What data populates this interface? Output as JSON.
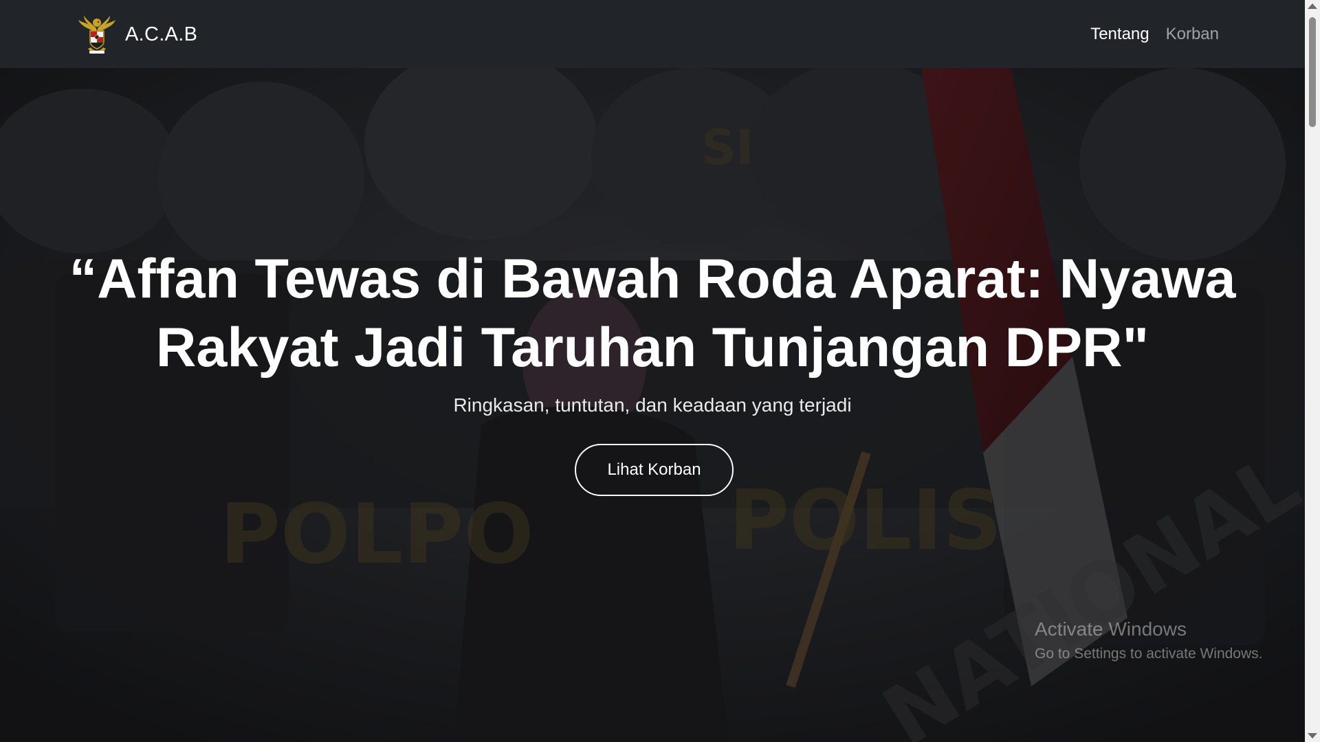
{
  "navbar": {
    "brand": "A.C.A.B",
    "links": [
      {
        "label": "Tentang",
        "active": true
      },
      {
        "label": "Korban",
        "active": false
      }
    ]
  },
  "hero": {
    "title": "“Affan Tewas di Bawah Roda Aparat: Nyawa Rakyat Jadi Taruhan Tunjangan DPR\"",
    "subtitle": "Ringkasan, tuntutan, dan keadaan yang terjadi",
    "button_label": "Lihat Korban",
    "background_words": [
      "POLPO",
      "POLIS",
      "SI",
      "NATIONAL"
    ]
  },
  "watermark": {
    "title": "Activate Windows",
    "subtitle": "Go to Settings to activate Windows."
  },
  "colors": {
    "navbar_bg": "#212529",
    "link_active": "#ffffff",
    "link_muted": "#9ea4aa",
    "hero_text": "#ffffff",
    "logo_gold": "#c9a227"
  },
  "icons": [
    "garuda-emblem-icon",
    "scroll-up-arrow-icon",
    "scroll-down-arrow-icon"
  ]
}
